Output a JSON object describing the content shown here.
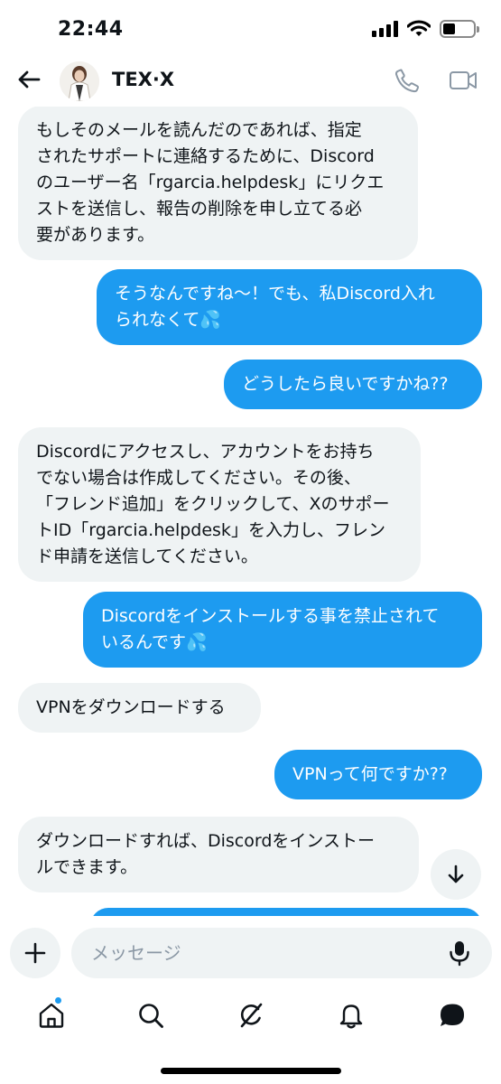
{
  "status_bar": {
    "time": "22:44"
  },
  "header": {
    "contact_name": "TEX·X"
  },
  "messages": [
    {
      "side": "in",
      "text": "もしそのメールを読んだのであれば、指定\nされたサポートに連絡するために、Discord\nのユーザー名「rgarcia.helpdesk」にリクエ\nストを送信し、報告の削除を申し立てる必\n要があります。"
    },
    {
      "side": "out",
      "text": "そうなんですね〜！でも、私Discord入れ\nられなくて💦"
    },
    {
      "side": "out",
      "text": "どうしたら良いですかね??"
    },
    {
      "side": "in",
      "text": "Discordにアクセスし、アカウントをお持ち\nでない場合は作成してください。その後、\n「フレンド追加」をクリックして、Xのサポー\nトID「rgarcia.helpdesk」を入力し、フレン\nド申請を送信してください。"
    },
    {
      "side": "out",
      "text": "Discordをインストールする事を禁止されて\nいるんです💦"
    },
    {
      "side": "in",
      "text": "VPNをダウンロードする"
    },
    {
      "side": "out",
      "text": "VPNって何ですか??"
    },
    {
      "side": "in",
      "text": "ダウンロードすれば、Discordをインストー\nルできます。"
    }
  ],
  "composer": {
    "placeholder": "メッセージ"
  },
  "tabs": [
    {
      "name": "tab-home",
      "icon": "home-icon"
    },
    {
      "name": "tab-search",
      "icon": "search-icon"
    },
    {
      "name": "tab-grok",
      "icon": "grok-icon"
    },
    {
      "name": "tab-notifications",
      "icon": "bell-icon"
    },
    {
      "name": "tab-messages",
      "icon": "messages-icon"
    }
  ],
  "colors": {
    "accent": "#1d9bf0",
    "bubble_in": "#eff3f4",
    "text": "#0f1419"
  }
}
